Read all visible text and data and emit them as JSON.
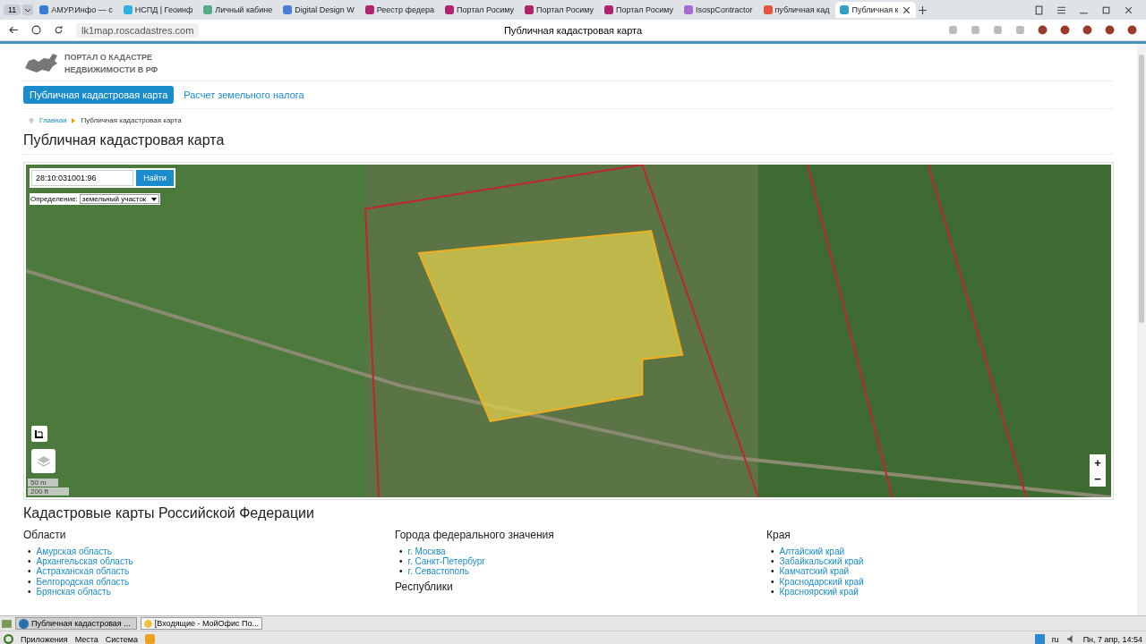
{
  "browser": {
    "tab_count": "11",
    "tabs": [
      {
        "title": "АМУР.Инфо — с",
        "selected": false
      },
      {
        "title": "НСПД | Геоинф",
        "selected": false
      },
      {
        "title": "Личный кабине",
        "selected": false
      },
      {
        "title": "Digital Design W",
        "selected": false
      },
      {
        "title": "Реестр федера",
        "selected": false
      },
      {
        "title": "Портал Росиму",
        "selected": false
      },
      {
        "title": "Портал Росиму",
        "selected": false
      },
      {
        "title": "Портал Росиму",
        "selected": false
      },
      {
        "title": "IsospContractor",
        "selected": false
      },
      {
        "title": "публичная кад",
        "selected": false
      },
      {
        "title": "Публичная к",
        "selected": true
      }
    ],
    "address": "lk1map.roscadastres.com",
    "page_title": "Публичная кадастровая карта"
  },
  "site": {
    "logo_lines": [
      "ПОРТАЛ О КАДАСТРЕ",
      "НЕДВИЖИМОСТИ В РФ"
    ],
    "nav": [
      {
        "label": "Публичная кадастровая карта",
        "selected": true
      },
      {
        "label": "Расчет земельного налога",
        "selected": false
      }
    ],
    "breadcrumb": {
      "home": "Главная",
      "current": "Публичная кадастровая карта"
    },
    "heading": "Публичная кадастровая карта"
  },
  "map": {
    "search_value": "28:10:031001:96",
    "search_button": "Найти",
    "definition_label": "Определение:",
    "definition_value": "земельный участок",
    "scale": [
      "50 m",
      "200 ft"
    ],
    "zoom_in": "+",
    "zoom_out": "−"
  },
  "regions": {
    "title": "Кадастровые карты Российской Федерации",
    "bullet": "•",
    "columns": [
      {
        "heading": "Области",
        "items": [
          "Амурская область",
          "Архангельская область",
          "Астраханская область",
          "Белгородская область",
          "Брянская область"
        ]
      },
      {
        "heading": "Города федерального значения",
        "items": [
          "г. Москва",
          "г. Санкт-Петербург",
          "г. Севастополь"
        ],
        "subheading": "Республики"
      },
      {
        "heading": "Края",
        "items": [
          "Алтайский край",
          "Забайкальский край",
          "Камчатский край",
          "Краснодарский край",
          "Красноярский край"
        ]
      }
    ]
  },
  "taskbar": {
    "windows": [
      {
        "title": "Публичная кадастровая ...",
        "selected": true
      },
      {
        "title": "[Входящие - МойОфис По...",
        "selected": false
      }
    ]
  },
  "panel": {
    "menus": [
      "Приложения",
      "Места",
      "Система"
    ],
    "layout": "ru",
    "clock": "Пн, 7 апр, 14:54"
  }
}
